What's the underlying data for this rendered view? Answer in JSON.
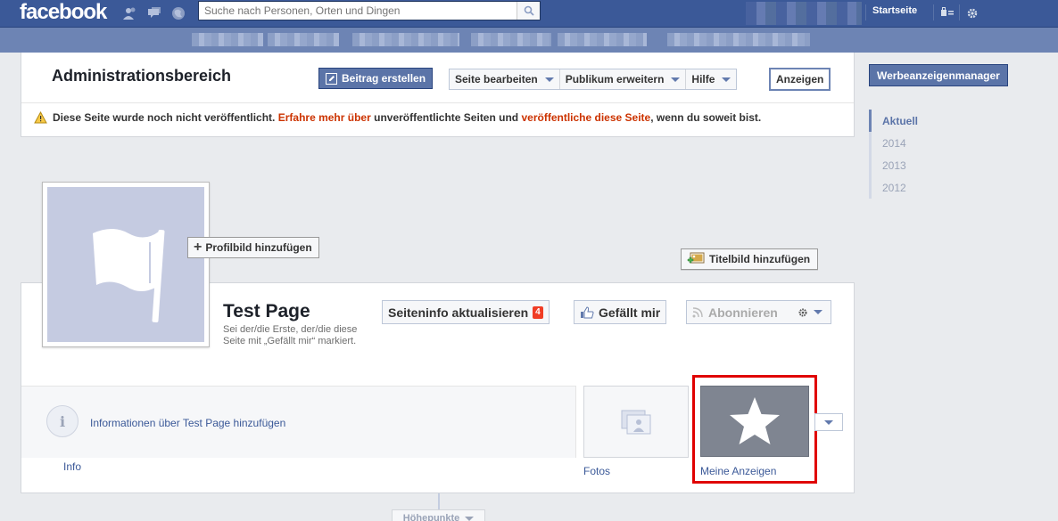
{
  "header": {
    "logo": "facebook",
    "search_placeholder": "Suche nach Personen, Orten und Dingen",
    "home_link": "Startseite",
    "icons": [
      "friend-requests-icon",
      "messages-icon",
      "notifications-globe-icon",
      "search-icon",
      "privacy-shortcuts-icon",
      "settings-gear-icon"
    ]
  },
  "admin": {
    "title": "Administrationsbereich",
    "create_post": "Beitrag erstellen",
    "edit_page": "Seite bearbeiten",
    "expand_audience": "Publikum erweitern",
    "help": "Hilfe",
    "show": "Anzeigen",
    "notice_pre": "Diese Seite wurde noch nicht veröffentlicht.",
    "notice_link1": "Erfahre mehr über",
    "notice_mid": "unveröffentlichte Seiten und",
    "notice_link2": "veröffentliche diese Seite",
    "notice_post": ", wenn du soweit bist."
  },
  "sidebar": {
    "ads_manager": "Werbeanzeigenmanager",
    "timeline": [
      {
        "label": "Aktuell",
        "active": true
      },
      {
        "label": "2014",
        "active": false
      },
      {
        "label": "2013",
        "active": false
      },
      {
        "label": "2012",
        "active": false
      }
    ]
  },
  "page": {
    "add_profile_pic": "Profilbild hinzufügen",
    "add_cover": "Titelbild hinzufügen",
    "name": "Test Page",
    "subtitle": "Sei der/die Erste, der/die diese Seite mit „Gefällt mir“ markiert.",
    "update_info": "Seiteninfo aktualisieren",
    "update_info_badge": "4",
    "like": "Gefällt mir",
    "subscribe": "Abonnieren"
  },
  "apps": {
    "info_link": "Informationen über Test Page hinzufügen",
    "info_label": "Info",
    "photos_label": "Fotos",
    "ads_label": "Meine Anzeigen"
  },
  "timeline_bottom": {
    "highlights": "Höhepunkte"
  },
  "colors": {
    "brand": "#3b5998",
    "sub_bar": "#6d84b4",
    "link_red": "#cc3300",
    "badge": "#f03d25",
    "highlight_box": "#e00000"
  }
}
